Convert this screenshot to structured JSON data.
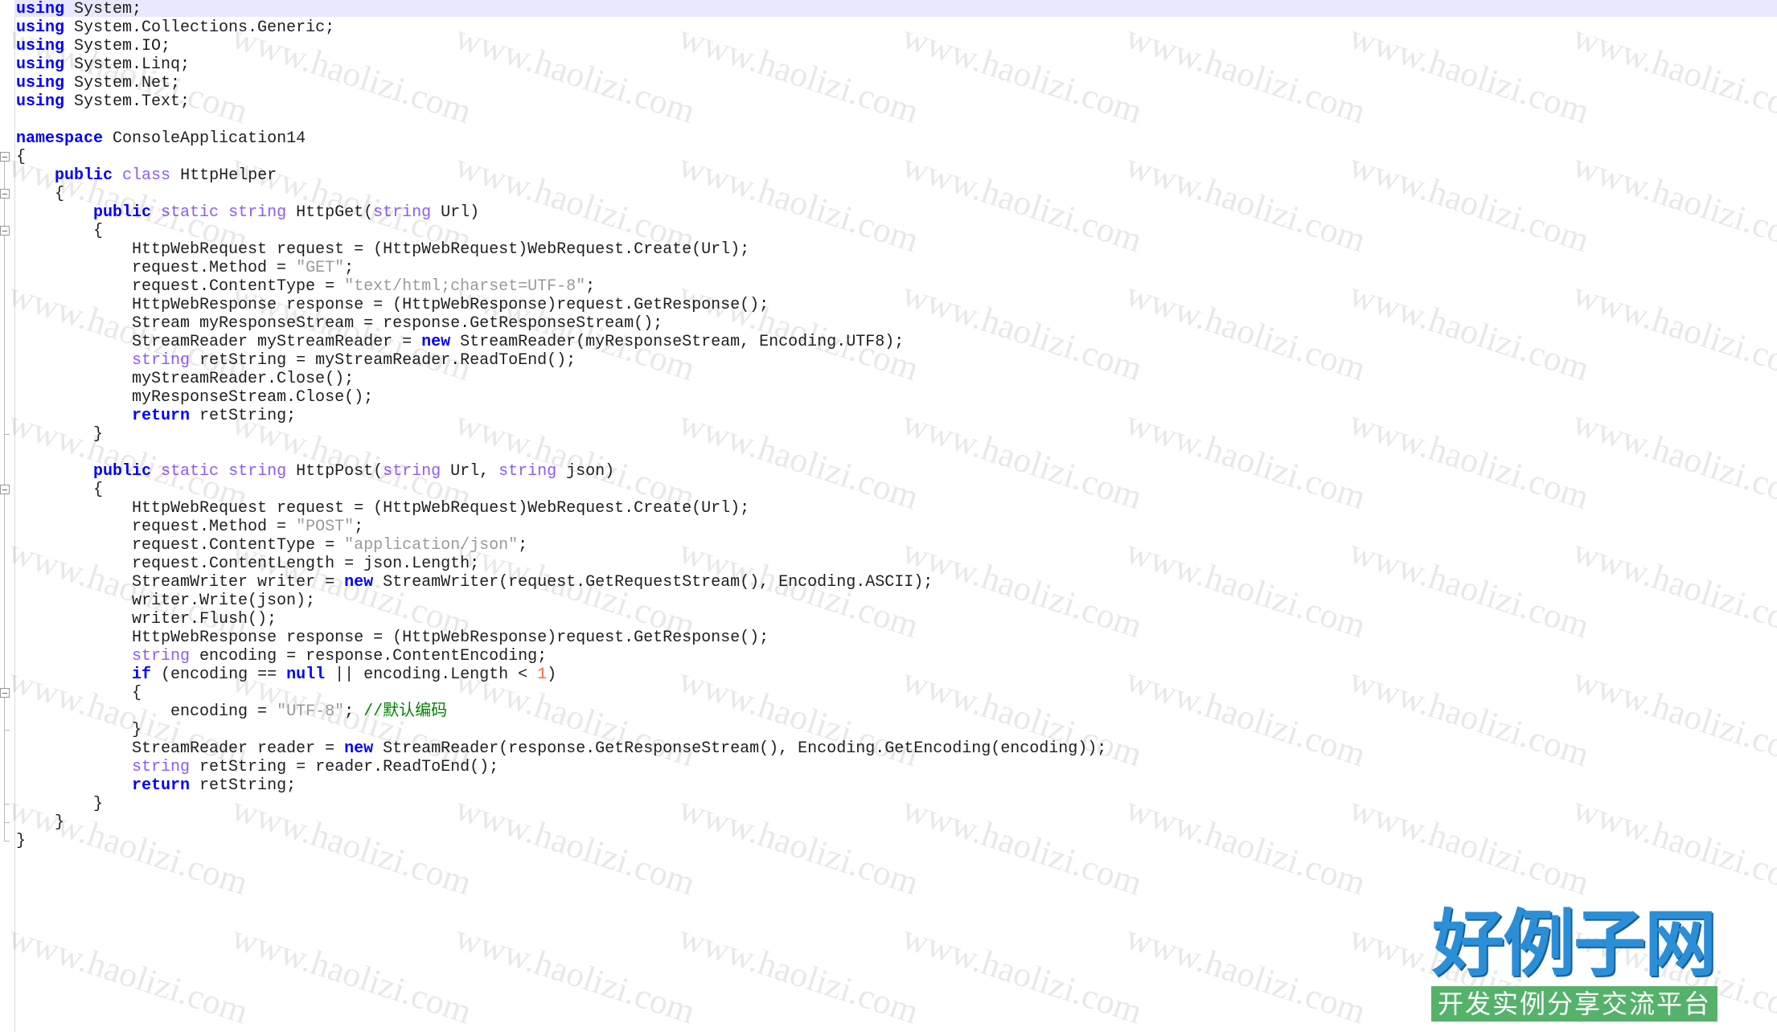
{
  "editor": {
    "lines": [
      [
        [
          "kw",
          "using"
        ],
        [
          "plain",
          " System;"
        ]
      ],
      [
        [
          "kw",
          "using"
        ],
        [
          "plain",
          " System.Collections.Generic;"
        ]
      ],
      [
        [
          "kw",
          "using"
        ],
        [
          "plain",
          " System.IO;"
        ]
      ],
      [
        [
          "kw",
          "using"
        ],
        [
          "plain",
          " System.Linq;"
        ]
      ],
      [
        [
          "kw",
          "using"
        ],
        [
          "plain",
          " System.Net;"
        ]
      ],
      [
        [
          "kw",
          "using"
        ],
        [
          "plain",
          " System.Text;"
        ]
      ],
      [],
      [
        [
          "kw",
          "namespace"
        ],
        [
          "plain",
          " ConsoleApplication14"
        ]
      ],
      [
        [
          "plain",
          "{"
        ]
      ],
      [
        [
          "plain",
          "    "
        ],
        [
          "kw",
          "public"
        ],
        [
          "plain",
          " "
        ],
        [
          "type",
          "class"
        ],
        [
          "plain",
          " HttpHelper"
        ]
      ],
      [
        [
          "plain",
          "    {"
        ]
      ],
      [
        [
          "plain",
          "        "
        ],
        [
          "kw",
          "public"
        ],
        [
          "plain",
          " "
        ],
        [
          "type",
          "static"
        ],
        [
          "plain",
          " "
        ],
        [
          "type",
          "string"
        ],
        [
          "plain",
          " HttpGet("
        ],
        [
          "type",
          "string"
        ],
        [
          "plain",
          " Url)"
        ]
      ],
      [
        [
          "plain",
          "        {"
        ]
      ],
      [
        [
          "plain",
          "            HttpWebRequest request = (HttpWebRequest)WebRequest.Create(Url);"
        ]
      ],
      [
        [
          "plain",
          "            request.Method = "
        ],
        [
          "str",
          "\"GET\""
        ],
        [
          "plain",
          ";"
        ]
      ],
      [
        [
          "plain",
          "            request.ContentType = "
        ],
        [
          "str",
          "\"text/html;charset=UTF-8\""
        ],
        [
          "plain",
          ";"
        ]
      ],
      [
        [
          "plain",
          "            HttpWebResponse response = (HttpWebResponse)request.GetResponse();"
        ]
      ],
      [
        [
          "plain",
          "            Stream myResponseStream = response.GetResponseStream();"
        ]
      ],
      [
        [
          "plain",
          "            StreamReader myStreamReader = "
        ],
        [
          "kw",
          "new"
        ],
        [
          "plain",
          " StreamReader(myResponseStream, Encoding.UTF8);"
        ]
      ],
      [
        [
          "plain",
          "            "
        ],
        [
          "type",
          "string"
        ],
        [
          "plain",
          " retString = myStreamReader.ReadToEnd();"
        ]
      ],
      [
        [
          "plain",
          "            myStreamReader.Close();"
        ]
      ],
      [
        [
          "plain",
          "            myResponseStream.Close();"
        ]
      ],
      [
        [
          "plain",
          "            "
        ],
        [
          "kw",
          "return"
        ],
        [
          "plain",
          " retString;"
        ]
      ],
      [
        [
          "plain",
          "        }"
        ]
      ],
      [],
      [
        [
          "plain",
          "        "
        ],
        [
          "kw",
          "public"
        ],
        [
          "plain",
          " "
        ],
        [
          "type",
          "static"
        ],
        [
          "plain",
          " "
        ],
        [
          "type",
          "string"
        ],
        [
          "plain",
          " HttpPost("
        ],
        [
          "type",
          "string"
        ],
        [
          "plain",
          " Url, "
        ],
        [
          "type",
          "string"
        ],
        [
          "plain",
          " json)"
        ]
      ],
      [
        [
          "plain",
          "        {"
        ]
      ],
      [
        [
          "plain",
          "            HttpWebRequest request = (HttpWebRequest)WebRequest.Create(Url);"
        ]
      ],
      [
        [
          "plain",
          "            request.Method = "
        ],
        [
          "str",
          "\"POST\""
        ],
        [
          "plain",
          ";"
        ]
      ],
      [
        [
          "plain",
          "            request.ContentType = "
        ],
        [
          "str",
          "\"application/json\""
        ],
        [
          "plain",
          ";"
        ]
      ],
      [
        [
          "plain",
          "            request.ContentLength = json.Length;"
        ]
      ],
      [
        [
          "plain",
          "            StreamWriter writer = "
        ],
        [
          "kw",
          "new"
        ],
        [
          "plain",
          " StreamWriter(request.GetRequestStream(), Encoding.ASCII);"
        ]
      ],
      [
        [
          "plain",
          "            writer.Write(json);"
        ]
      ],
      [
        [
          "plain",
          "            writer.Flush();"
        ]
      ],
      [
        [
          "plain",
          "            HttpWebResponse response = (HttpWebResponse)request.GetResponse();"
        ]
      ],
      [
        [
          "plain",
          "            "
        ],
        [
          "type",
          "string"
        ],
        [
          "plain",
          " encoding = response.ContentEncoding;"
        ]
      ],
      [
        [
          "plain",
          "            "
        ],
        [
          "kw",
          "if"
        ],
        [
          "plain",
          " (encoding == "
        ],
        [
          "kw",
          "null"
        ],
        [
          "plain",
          " || encoding.Length < "
        ],
        [
          "num",
          "1"
        ],
        [
          "plain",
          ")"
        ]
      ],
      [
        [
          "plain",
          "            {"
        ]
      ],
      [
        [
          "plain",
          "                encoding = "
        ],
        [
          "str",
          "\"UTF-8\""
        ],
        [
          "plain",
          "; "
        ],
        [
          "comment",
          "//默认编码"
        ]
      ],
      [
        [
          "plain",
          "            }"
        ]
      ],
      [
        [
          "plain",
          "            StreamReader reader = "
        ],
        [
          "kw",
          "new"
        ],
        [
          "plain",
          " StreamReader(response.GetResponseStream(), Encoding.GetEncoding(encoding));"
        ]
      ],
      [
        [
          "plain",
          "            "
        ],
        [
          "type",
          "string"
        ],
        [
          "plain",
          " retString = reader.ReadToEnd();"
        ]
      ],
      [
        [
          "plain",
          "            "
        ],
        [
          "kw",
          "return"
        ],
        [
          "plain",
          " retString;"
        ]
      ],
      [
        [
          "plain",
          "        }"
        ]
      ],
      [
        [
          "plain",
          "    }"
        ]
      ],
      [
        [
          "plain",
          "}"
        ]
      ]
    ],
    "fold_regions": [
      {
        "start": 8,
        "end": 45
      },
      {
        "start": 10,
        "end": 44
      },
      {
        "start": 12,
        "end": 23
      },
      {
        "start": 26,
        "end": 43
      },
      {
        "start": 37,
        "end": 39
      }
    ]
  },
  "colors": {
    "keyword": "#0000ff",
    "type": "#8b5cf6",
    "string": "#9a9a9a",
    "number": "#ff6a3d",
    "comment": "#008000",
    "text": "#1e1e1e",
    "current_line": "#e8e8ff"
  },
  "watermark": {
    "text": "www.haolizi.com"
  },
  "logo": {
    "title": "好例子网",
    "subtitle": "开发实例分享交流平台"
  }
}
